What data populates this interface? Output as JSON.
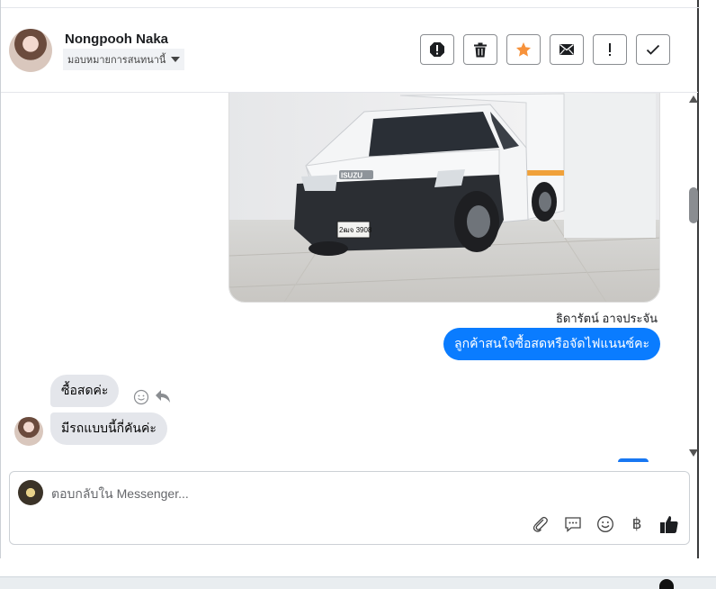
{
  "header": {
    "contact_name": "Nongpooh Naka",
    "assign_label": "มอบหมายการสนทนานี้",
    "toolbar": [
      {
        "name": "mark-spam-button",
        "icon": "exclamation-octagon-icon"
      },
      {
        "name": "delete-button",
        "icon": "trash-icon"
      },
      {
        "name": "star-button",
        "icon": "star-icon",
        "color": "#f7923b"
      },
      {
        "name": "mark-unread-button",
        "icon": "envelope-icon"
      },
      {
        "name": "follow-up-button",
        "icon": "exclamation-icon"
      },
      {
        "name": "mark-done-button",
        "icon": "checkmark-icon"
      }
    ]
  },
  "conversation": {
    "image_alt": "รถกระบะตู้ทึบ ISUZU สีขาว",
    "plate_text": "2ฒจ 3908",
    "brand_text": "ISUZU",
    "sender_name": "ธิดารัตน์ อาจประจัน",
    "outgoing_message": "ลูกค้าสนใจซื้อสดหรือจัดไฟแนนซ์คะ",
    "incoming_messages": [
      {
        "text": "ซื้อสดค่ะ"
      },
      {
        "text": "มีรถแบบนี้กี่คันค่ะ"
      }
    ]
  },
  "composer": {
    "placeholder": "ตอบกลับใน Messenger...",
    "baht_symbol": "฿",
    "icons": [
      "paperclip-icon",
      "saved-reply-icon",
      "emoji-icon",
      "payment-icon",
      "thumbs-up-icon"
    ]
  },
  "colors": {
    "accent": "#0a7cff",
    "incoming_bubble": "#e4e6eb",
    "star": "#f7923b"
  }
}
